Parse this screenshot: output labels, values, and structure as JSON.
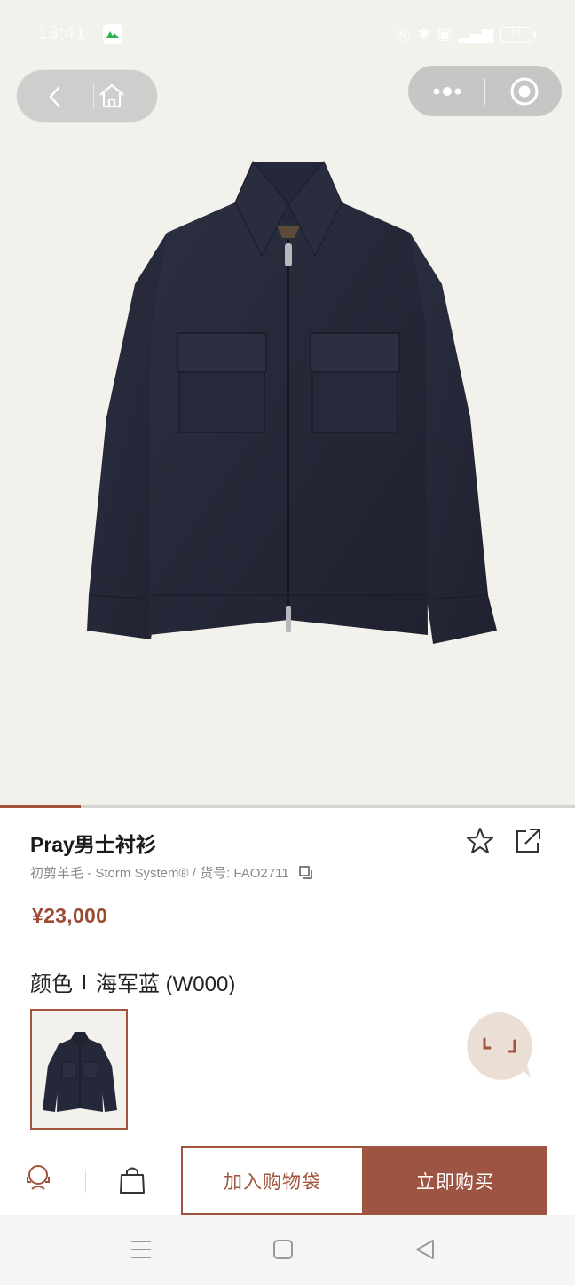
{
  "status_bar": {
    "time": "13:41",
    "battery": "61"
  },
  "gallery": {
    "progress": 0.14
  },
  "product": {
    "title": "Pray男士衬衫",
    "subtitle": "初剪羊毛 - Storm System® / 货号:  FAO2711",
    "price": "¥23,000",
    "color_label": "颜色",
    "color_value": "海军蓝 (W000)"
  },
  "actions": {
    "add_to_bag": "加入购物袋",
    "buy_now": "立即购买"
  },
  "colors": {
    "accent": "#a2533c",
    "price": "#9b4a35",
    "hero_bg": "#f3f1ec",
    "jacket": "#252838"
  },
  "icons": [
    "back-icon",
    "home-icon",
    "more-icon",
    "close-target-icon",
    "star-icon",
    "share-icon",
    "copy-icon",
    "chat-icon",
    "customer-service-icon",
    "shopping-bag-icon",
    "menu-icon",
    "square-icon",
    "triangle-back-icon"
  ]
}
